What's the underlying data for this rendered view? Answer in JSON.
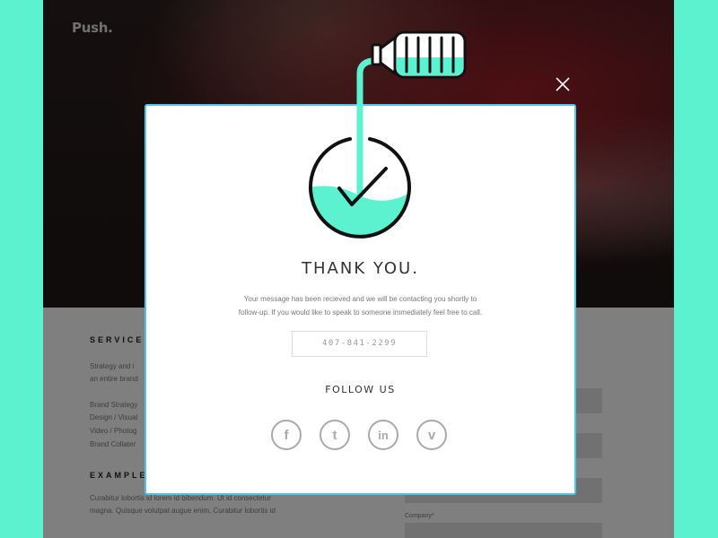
{
  "brand": {
    "logo": "Push."
  },
  "sections": {
    "services_heading": "SERVICE",
    "services_text": "Strategy and i",
    "services_text2": "an entire brand",
    "services_list": [
      "Brand Strategy",
      "Design / Visual",
      "Video / Photog",
      "Brand Collater"
    ],
    "examples_heading": "EXAMPLE",
    "examples_text": "Curabitur lobortis id lorem id bibendum. Ut id consectetur",
    "examples_text2": "magna. Quisque volutpat augue enim, Curabitur lobortis id"
  },
  "form": {
    "company_label": "Company*"
  },
  "modal": {
    "title": "THANK YOU.",
    "message_line1": "Your message has been recieved and we will be contacting you shortly to",
    "message_line2": "follow-up. If you would like to speak to someone immediately feel free to call.",
    "phone": "407-841-2299",
    "follow_label": "FOLLOW US",
    "social": [
      {
        "name": "facebook",
        "glyph": "f"
      },
      {
        "name": "twitter",
        "glyph": "t"
      },
      {
        "name": "linkedin",
        "glyph": "in"
      },
      {
        "name": "vimeo",
        "glyph": "v"
      }
    ]
  },
  "colors": {
    "accent": "#5cf2d0",
    "modal_border": "#4fc6e8",
    "ink": "#111111"
  }
}
